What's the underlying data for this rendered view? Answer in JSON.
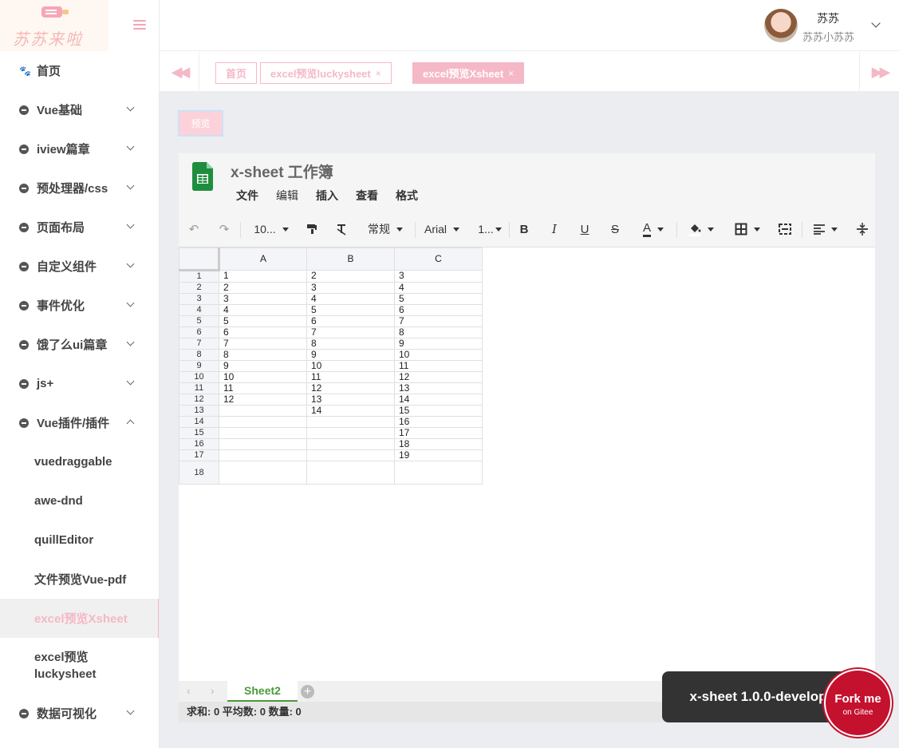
{
  "logo": {
    "text": "苏苏来啦"
  },
  "sidebar": {
    "items": [
      {
        "label": "首页"
      },
      {
        "label": "Vue基础"
      },
      {
        "label": "iview篇章"
      },
      {
        "label": "预处理器/css"
      },
      {
        "label": "页面布局"
      },
      {
        "label": "自定义组件"
      },
      {
        "label": "事件优化"
      },
      {
        "label": "饿了么ui篇章"
      },
      {
        "label": "js+"
      },
      {
        "label": "Vue插件/插件"
      }
    ],
    "sub_items": [
      {
        "label": "vuedraggable"
      },
      {
        "label": "awe-dnd"
      },
      {
        "label": "quillEditor"
      },
      {
        "label": "文件预览Vue-pdf"
      },
      {
        "label": "excel预览Xsheet"
      },
      {
        "label": "excel预览 luckysheet"
      }
    ],
    "after_items": [
      {
        "label": "数据可视化"
      }
    ]
  },
  "header": {
    "user_name": "苏苏",
    "user_sub": "苏苏小苏苏"
  },
  "tabs": {
    "prev": "◀◀",
    "next": "▶▶",
    "items": [
      {
        "label": "首页"
      },
      {
        "label": "excel预览luckysheet",
        "close": "×"
      },
      {
        "label": "excel预览Xsheet",
        "close": "×"
      }
    ]
  },
  "content": {
    "preview_button": "预览"
  },
  "sheet": {
    "title": "x-sheet 工作簿",
    "menu": [
      "文件",
      "编辑",
      "插入",
      "查看",
      "格式"
    ],
    "toolbar": {
      "undo": "↶",
      "redo": "↷",
      "zoom": "10...",
      "format": "常规",
      "font": "Arial",
      "font_size": "1...",
      "bold": "B",
      "italic": "I",
      "underline": "U",
      "strike": "S",
      "text_color": "A"
    },
    "columns": [
      "A",
      "B",
      "C"
    ],
    "rows": [
      {
        "n": "1",
        "a": "1",
        "b": "2",
        "c": "3"
      },
      {
        "n": "2",
        "a": "2",
        "b": "3",
        "c": "4"
      },
      {
        "n": "3",
        "a": "3",
        "b": "4",
        "c": "5"
      },
      {
        "n": "4",
        "a": "4",
        "b": "5",
        "c": "6"
      },
      {
        "n": "5",
        "a": "5",
        "b": "6",
        "c": "7"
      },
      {
        "n": "6",
        "a": "6",
        "b": "7",
        "c": "8"
      },
      {
        "n": "7",
        "a": "7",
        "b": "8",
        "c": "9"
      },
      {
        "n": "8",
        "a": "8",
        "b": "9",
        "c": "10"
      },
      {
        "n": "9",
        "a": "9",
        "b": "10",
        "c": "11"
      },
      {
        "n": "10",
        "a": "10",
        "b": "11",
        "c": "12"
      },
      {
        "n": "11",
        "a": "11",
        "b": "12",
        "c": "13"
      },
      {
        "n": "12",
        "a": "12",
        "b": "13",
        "c": "14"
      },
      {
        "n": "13",
        "a": "",
        "b": "14",
        "c": "15"
      },
      {
        "n": "14",
        "a": "",
        "b": "",
        "c": "16"
      },
      {
        "n": "15",
        "a": "",
        "b": "",
        "c": "17"
      },
      {
        "n": "16",
        "a": "",
        "b": "",
        "c": "18"
      },
      {
        "n": "17",
        "a": "",
        "b": "",
        "c": "19"
      },
      {
        "n": "18",
        "a": "",
        "b": "",
        "c": ""
      }
    ],
    "sheet_tab": "Sheet2",
    "add_sheet": "+",
    "status": "求和: 0  平均数: 0  数量: 0",
    "toast": "x-sheet 1.0.0-develop"
  },
  "fork": {
    "line1": "Fork me",
    "line2": "on Gitee"
  },
  "colors": {
    "accent": "#f5b8c6",
    "sheet_green": "#4b9a3b",
    "fork_red": "#c4112e"
  }
}
